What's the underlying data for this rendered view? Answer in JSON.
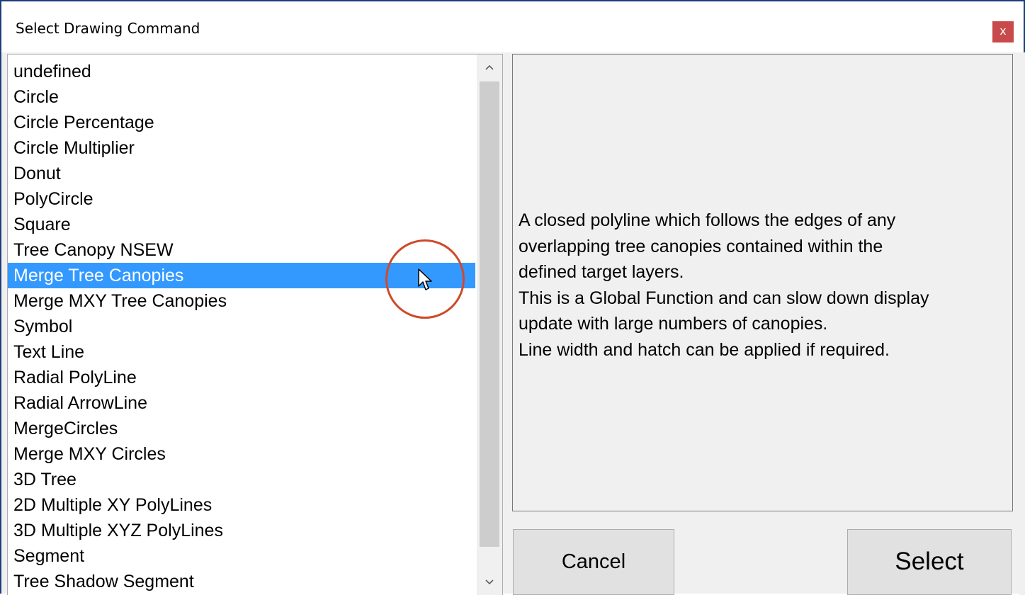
{
  "window": {
    "title": "Select Drawing Command",
    "close_label": "x"
  },
  "command_list": {
    "items": [
      "undefined",
      "Circle",
      "Circle Percentage",
      "Circle Multiplier",
      "Donut",
      "PolyCircle",
      "Square",
      "Tree Canopy NSEW",
      "Merge Tree Canopies",
      "Merge MXY Tree Canopies",
      "Symbol",
      "Text Line",
      "Radial PolyLine",
      "Radial ArrowLine",
      "MergeCircles",
      "Merge MXY Circles",
      "3D Tree",
      "2D Multiple XY PolyLines",
      "3D Multiple XYZ PolyLines",
      "Segment",
      "Tree Shadow Segment"
    ],
    "selected_index": 8
  },
  "description": {
    "text": "A closed polyline which follows the edges of any\noverlapping tree canopies contained within the\ndefined target layers.\nThis is a Global Function and can slow down display\nupdate with large numbers of canopies.\nLine width and hatch can be applied if required."
  },
  "buttons": {
    "cancel_label": "Cancel",
    "select_label": "Select"
  },
  "colors": {
    "selection": "#3399ff",
    "highlight_circle": "#cf4a2a",
    "title_border": "#1c3e7a",
    "close_button": "#c94a4a"
  },
  "icons": {
    "scroll_up": "chevron-up-icon",
    "scroll_down": "chevron-down-icon",
    "close": "close-icon",
    "cursor": "mouse-pointer-icon"
  }
}
